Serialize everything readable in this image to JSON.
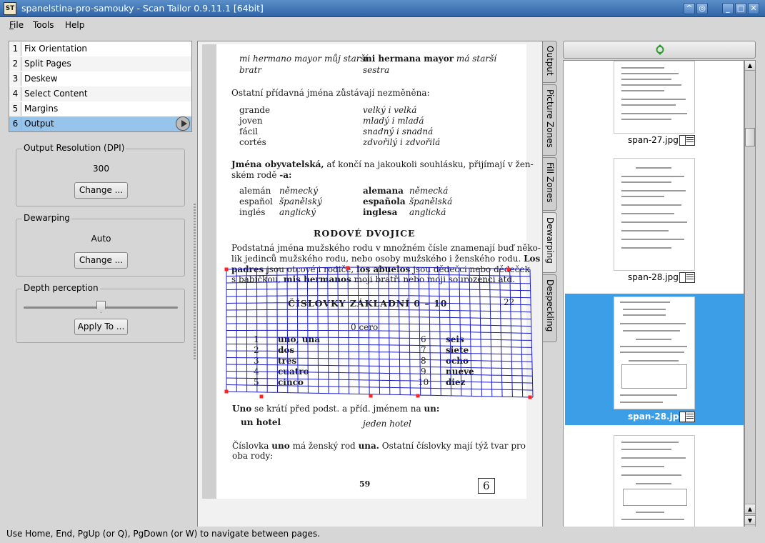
{
  "window": {
    "icon_text": "ST",
    "title": "spanelstina-pro-samouky - Scan Tailor 0.9.11.1 [64bit]"
  },
  "menu": [
    "File",
    "Tools",
    "Help"
  ],
  "stages": [
    {
      "num": "1",
      "label": "Fix Orientation"
    },
    {
      "num": "2",
      "label": "Split Pages"
    },
    {
      "num": "3",
      "label": "Deskew"
    },
    {
      "num": "4",
      "label": "Select Content"
    },
    {
      "num": "5",
      "label": "Margins"
    },
    {
      "num": "6",
      "label": "Output"
    }
  ],
  "output_resolution": {
    "title": "Output Resolution (DPI)",
    "value": "300",
    "change_label": "Change ..."
  },
  "dewarping": {
    "title": "Dewarping",
    "value": "Auto",
    "change_label": "Change ..."
  },
  "depth": {
    "title": "Depth perception",
    "apply_label": "Apply To ...",
    "level": 0.5
  },
  "tabs": [
    "Output",
    "Picture Zones",
    "Fill Zones",
    "Dewarping",
    "Despeckling"
  ],
  "page": {
    "r1a": "mi hermano mayor",
    "r1b": "můj starší",
    "r1c": "mi hermana mayor",
    "r1d": "má starší",
    "r2a": "bratr",
    "r2b": "sestra",
    "p1": "Ostatní přídavná jména zůstávají nezměněna:",
    "w1": "grande",
    "w1t": "velký i velká",
    "w2": "joven",
    "w2t": "mladý i mladá",
    "w3": "fácil",
    "w3t": "snadný i snadná",
    "w4": "cortés",
    "w4t": "zdvořilý i zdvořilá",
    "p2a": "Jména obyvatelská,",
    "p2b": "ať končí na jakoukoli souhlásku, přijímají v žen-",
    "p2c": "ském rodě",
    "p2d": "-a:",
    "n1": "alemán",
    "n1t": "německý",
    "n1b": "alemana",
    "n1bt": "německá",
    "n2": "español",
    "n2t": "španělský",
    "n2b": "española",
    "n2bt": "španělská",
    "n3": "inglés",
    "n3t": "anglický",
    "n3b": "inglesa",
    "n3bt": "anglická",
    "heading": "RODOVÉ DVOJICE",
    "p3a": "Podstatná jména mužského rodu v množném čísle znamenají buď něko-",
    "p3b": "lik jedinců mužského rodu, nebo osoby mužského i ženského rodu.",
    "p3c": "Los",
    "p3d": "padres",
    "p3e": "jsou otcové i rodiče,",
    "p3f": "los abuelos",
    "p3g": "jsou dědečci nebo dědeček",
    "p3h": "s babičkou,",
    "p3i": "mis hermanos",
    "p3j": "moji bratři nebo moji sourozenci atd.",
    "table_title": "ČÍSLOVKY ZÁKLADNÍ 0 – 10",
    "table_num": "22",
    "t0": "0 cero",
    "tl1n": "1",
    "tl1": "uno, una",
    "tr1n": "6",
    "tr1": "seis",
    "tl2n": "2",
    "tl2": "dos",
    "tr2n": "7",
    "tr2": "siete",
    "tl3n": "3",
    "tl3": "tres",
    "tr3n": "8",
    "tr3": "ocho",
    "tl4n": "4",
    "tl4": "cuatro",
    "tr4n": "9",
    "tr4": "nueve",
    "tl5n": "5",
    "tl5": "cinco",
    "tr5n": "10",
    "tr5": "diez",
    "p4a": "Uno",
    "p4b": "se krátí před podst. a příd. jménem na",
    "p4c": "un:",
    "p5a": "un hotel",
    "p5b": "jeden hotel",
    "p6a": "Číslovka",
    "p6b": "uno",
    "p6c": "má ženský rod",
    "p6d": "una.",
    "p6e": "Ostatní číslovky mají týž tvar pro",
    "p6f": "oba rody:",
    "folio": "59",
    "chapter": "6"
  },
  "thumbnails": [
    {
      "caption": "span-27.jpg",
      "selected": false
    },
    {
      "caption": "span-28.jpg",
      "selected": false
    },
    {
      "caption": "span-28.jpg",
      "selected": true
    },
    {
      "caption": "",
      "selected": false
    }
  ],
  "status": "Use Home, End, PgUp (or Q), PgDown (or W) to navigate between pages."
}
